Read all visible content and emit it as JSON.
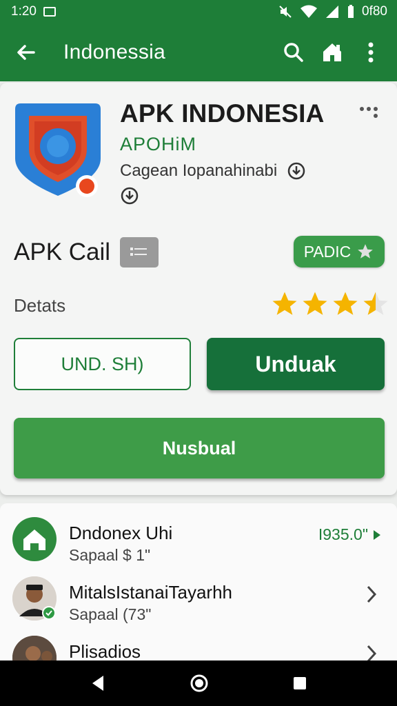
{
  "status_bar": {
    "time": "1:20",
    "battery_text": "0f80"
  },
  "app_bar": {
    "title": "Indonessia",
    "back_icon": "arrow-left-icon",
    "search_icon": "search-icon",
    "home_icon": "home-icon",
    "more_icon": "more-vert-icon"
  },
  "app": {
    "name": "APK INDONESIA",
    "code": "APOHiM",
    "category": "Cagean Iopanahinabi"
  },
  "section": {
    "title": "APK Cail",
    "badge": "PADIC"
  },
  "details": {
    "label": "Detats",
    "rating": 3.5,
    "max_rating": 5
  },
  "buttons": {
    "secondary": "UND. SH)",
    "primary": "Unduak",
    "wide": "Nusbual"
  },
  "list": [
    {
      "title": "Dndonex Uhi",
      "subtitle": "Sapaal $ 1\"",
      "meta": "I935.0\""
    },
    {
      "title": "MitalsIstanaiTayarhh",
      "subtitle": "Sapaal (73\""
    },
    {
      "title": "Plisadios",
      "subtitle": ""
    }
  ],
  "colors": {
    "brand_green": "#1e7e38",
    "button_green": "#3e9c48",
    "star": "#f5b400"
  }
}
